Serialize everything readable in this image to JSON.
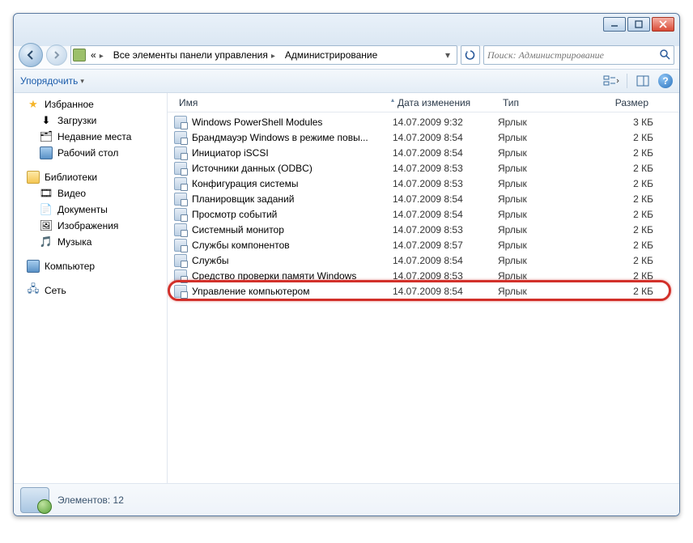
{
  "window_controls": {
    "min": "–",
    "max": "❐",
    "close": "✕"
  },
  "breadcrumb": {
    "root_icon": "control-panel",
    "items": [
      "Все элементы панели управления",
      "Администрирование"
    ]
  },
  "search": {
    "placeholder": "Поиск: Администрирование"
  },
  "toolbar": {
    "organize": "Упорядочить"
  },
  "sidebar": {
    "favorites": {
      "label": "Избранное",
      "items": [
        "Загрузки",
        "Недавние места",
        "Рабочий стол"
      ]
    },
    "libraries": {
      "label": "Библиотеки",
      "items": [
        "Видео",
        "Документы",
        "Изображения",
        "Музыка"
      ]
    },
    "computer": {
      "label": "Компьютер"
    },
    "network": {
      "label": "Сеть"
    }
  },
  "columns": {
    "name": "Имя",
    "date": "Дата изменения",
    "type": "Тип",
    "size": "Размер"
  },
  "rows": [
    {
      "name": "Windows PowerShell Modules",
      "date": "14.07.2009 9:32",
      "type": "Ярлык",
      "size": "3 КБ"
    },
    {
      "name": "Брандмауэр Windows в режиме повы...",
      "date": "14.07.2009 8:54",
      "type": "Ярлык",
      "size": "2 КБ"
    },
    {
      "name": "Инициатор iSCSI",
      "date": "14.07.2009 8:54",
      "type": "Ярлык",
      "size": "2 КБ"
    },
    {
      "name": "Источники данных (ODBC)",
      "date": "14.07.2009 8:53",
      "type": "Ярлык",
      "size": "2 КБ"
    },
    {
      "name": "Конфигурация системы",
      "date": "14.07.2009 8:53",
      "type": "Ярлык",
      "size": "2 КБ"
    },
    {
      "name": "Планировщик заданий",
      "date": "14.07.2009 8:54",
      "type": "Ярлык",
      "size": "2 КБ"
    },
    {
      "name": "Просмотр событий",
      "date": "14.07.2009 8:54",
      "type": "Ярлык",
      "size": "2 КБ"
    },
    {
      "name": "Системный монитор",
      "date": "14.07.2009 8:53",
      "type": "Ярлык",
      "size": "2 КБ"
    },
    {
      "name": "Службы компонентов",
      "date": "14.07.2009 8:57",
      "type": "Ярлык",
      "size": "2 КБ"
    },
    {
      "name": "Службы",
      "date": "14.07.2009 8:54",
      "type": "Ярлык",
      "size": "2 КБ"
    },
    {
      "name": "Средство проверки памяти Windows",
      "date": "14.07.2009 8:53",
      "type": "Ярлык",
      "size": "2 КБ"
    },
    {
      "name": "Управление компьютером",
      "date": "14.07.2009 8:54",
      "type": "Ярлык",
      "size": "2 КБ",
      "highlighted": true
    }
  ],
  "status": {
    "label": "Элементов:",
    "count": "12"
  }
}
